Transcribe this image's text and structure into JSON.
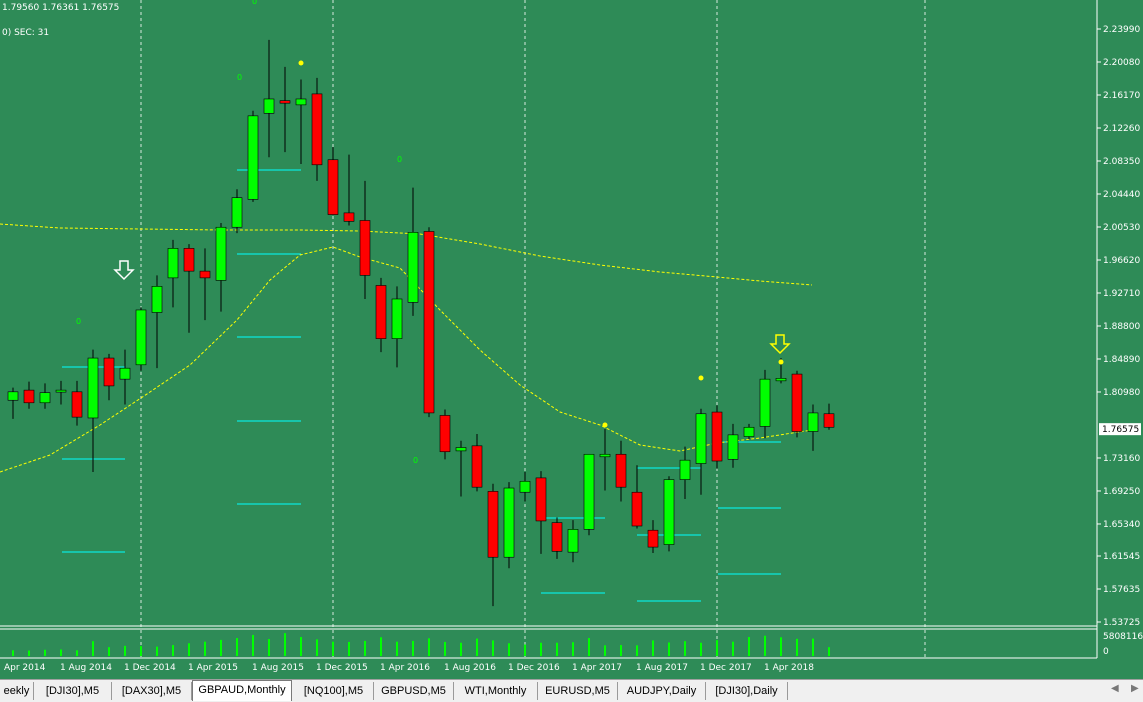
{
  "chart_data": {
    "type": "candlestick",
    "symbol": "GBPAUD",
    "timeframe": "Monthly",
    "info_line": "1.79560 1.76361 1.76575",
    "sec_line": "0)  SEC: 31",
    "current_price": "1.76575",
    "price_axis_labels": [
      "2.23990",
      "2.20080",
      "2.16170",
      "2.12260",
      "2.08350",
      "2.04440",
      "2.00530",
      "1.96620",
      "1.92710",
      "1.88800",
      "1.84890",
      "1.80980",
      "1.73160",
      "1.69250",
      "1.65340",
      "1.61545",
      "1.57635",
      "1.53725"
    ],
    "date_axis_labels": [
      "Apr 2014",
      "1 Aug 2014",
      "1 Dec 2014",
      "1 Apr 2015",
      "1 Aug 2015",
      "1 Dec 2015",
      "1 Apr 2016",
      "1 Aug 2016",
      "1 Dec 2016",
      "1 Apr 2017",
      "1 Aug 2017",
      "1 Dec 2017",
      "1 Apr 2018"
    ],
    "volume_axis_labels": [
      "5808116",
      "0"
    ],
    "zero_markers": [
      "0",
      "0",
      "0",
      "0",
      "0"
    ],
    "candles": [
      {
        "o": 1.8,
        "h": 1.815,
        "l": 1.778,
        "c": 1.81
      },
      {
        "o": 1.812,
        "h": 1.822,
        "l": 1.79,
        "c": 1.797
      },
      {
        "o": 1.797,
        "h": 1.82,
        "l": 1.79,
        "c": 1.809
      },
      {
        "o": 1.81,
        "h": 1.823,
        "l": 1.795,
        "c": 1.812
      },
      {
        "o": 1.81,
        "h": 1.823,
        "l": 1.77,
        "c": 1.78
      },
      {
        "o": 1.779,
        "h": 1.86,
        "l": 1.715,
        "c": 1.85
      },
      {
        "o": 1.85,
        "h": 1.855,
        "l": 1.8,
        "c": 1.817
      },
      {
        "o": 1.825,
        "h": 1.86,
        "l": 1.795,
        "c": 1.838
      },
      {
        "o": 1.842,
        "h": 1.91,
        "l": 1.835,
        "c": 1.907
      },
      {
        "o": 1.904,
        "h": 1.948,
        "l": 1.838,
        "c": 1.935
      },
      {
        "o": 1.945,
        "h": 1.99,
        "l": 1.91,
        "c": 1.98
      },
      {
        "o": 1.98,
        "h": 1.985,
        "l": 1.88,
        "c": 1.953
      },
      {
        "o": 1.953,
        "h": 1.98,
        "l": 1.895,
        "c": 1.945
      },
      {
        "o": 1.942,
        "h": 2.01,
        "l": 1.905,
        "c": 2.005
      },
      {
        "o": 2.005,
        "h": 2.05,
        "l": 1.998,
        "c": 2.04
      },
      {
        "o": 2.038,
        "h": 2.143,
        "l": 2.035,
        "c": 2.137
      },
      {
        "o": 2.14,
        "h": 2.227,
        "l": 2.088,
        "c": 2.157
      },
      {
        "o": 2.155,
        "h": 2.195,
        "l": 2.094,
        "c": 2.152
      },
      {
        "o": 2.15,
        "h": 2.18,
        "l": 2.08,
        "c": 2.157
      },
      {
        "o": 2.163,
        "h": 2.182,
        "l": 2.06,
        "c": 2.079
      },
      {
        "o": 2.085,
        "h": 2.1,
        "l": 2.02,
        "c": 2.02
      },
      {
        "o": 2.022,
        "h": 2.091,
        "l": 2.007,
        "c": 2.012
      },
      {
        "o": 2.013,
        "h": 2.06,
        "l": 1.92,
        "c": 1.948
      },
      {
        "o": 1.936,
        "h": 1.945,
        "l": 1.857,
        "c": 1.873
      },
      {
        "o": 1.873,
        "h": 1.935,
        "l": 1.839,
        "c": 1.92
      },
      {
        "o": 1.916,
        "h": 2.052,
        "l": 1.9,
        "c": 1.999
      },
      {
        "o": 2.0,
        "h": 2.005,
        "l": 1.78,
        "c": 1.785
      },
      {
        "o": 1.782,
        "h": 1.789,
        "l": 1.73,
        "c": 1.739
      },
      {
        "o": 1.74,
        "h": 1.752,
        "l": 1.686,
        "c": 1.744
      },
      {
        "o": 1.746,
        "h": 1.76,
        "l": 1.692,
        "c": 1.697
      },
      {
        "o": 1.692,
        "h": 1.701,
        "l": 1.556,
        "c": 1.614
      },
      {
        "o": 1.614,
        "h": 1.703,
        "l": 1.601,
        "c": 1.696
      },
      {
        "o": 1.691,
        "h": 1.715,
        "l": 1.68,
        "c": 1.704
      },
      {
        "o": 1.708,
        "h": 1.716,
        "l": 1.618,
        "c": 1.657
      },
      {
        "o": 1.655,
        "h": 1.661,
        "l": 1.612,
        "c": 1.621
      },
      {
        "o": 1.62,
        "h": 1.658,
        "l": 1.608,
        "c": 1.647
      },
      {
        "o": 1.647,
        "h": 1.735,
        "l": 1.64,
        "c": 1.736
      },
      {
        "o": 1.733,
        "h": 1.766,
        "l": 1.693,
        "c": 1.736
      },
      {
        "o": 1.736,
        "h": 1.752,
        "l": 1.68,
        "c": 1.697
      },
      {
        "o": 1.691,
        "h": 1.723,
        "l": 1.648,
        "c": 1.651
      },
      {
        "o": 1.646,
        "h": 1.658,
        "l": 1.619,
        "c": 1.626
      },
      {
        "o": 1.629,
        "h": 1.71,
        "l": 1.621,
        "c": 1.706
      },
      {
        "o": 1.706,
        "h": 1.745,
        "l": 1.683,
        "c": 1.729
      },
      {
        "o": 1.725,
        "h": 1.79,
        "l": 1.688,
        "c": 1.784
      },
      {
        "o": 1.786,
        "h": 1.794,
        "l": 1.719,
        "c": 1.728
      },
      {
        "o": 1.73,
        "h": 1.772,
        "l": 1.72,
        "c": 1.759
      },
      {
        "o": 1.757,
        "h": 1.772,
        "l": 1.754,
        "c": 1.768
      },
      {
        "o": 1.769,
        "h": 1.836,
        "l": 1.755,
        "c": 1.825
      },
      {
        "o": 1.823,
        "h": 1.85,
        "l": 1.82,
        "c": 1.826
      },
      {
        "o": 1.831,
        "h": 1.835,
        "l": 1.756,
        "c": 1.763
      },
      {
        "o": 1.763,
        "h": 1.795,
        "l": 1.74,
        "c": 1.785
      },
      {
        "o": 1.784,
        "h": 1.796,
        "l": 1.765,
        "c": 1.768
      }
    ],
    "volumes": [
      0.22,
      0.21,
      0.24,
      0.25,
      0.22,
      0.57,
      0.34,
      0.39,
      0.38,
      0.36,
      0.42,
      0.49,
      0.55,
      0.62,
      0.69,
      0.81,
      0.65,
      0.88,
      0.73,
      0.64,
      0.55,
      0.54,
      0.58,
      0.72,
      0.55,
      0.58,
      0.68,
      0.54,
      0.51,
      0.67,
      0.6,
      0.49,
      0.44,
      0.51,
      0.51,
      0.53,
      0.69,
      0.41,
      0.42,
      0.41,
      0.6,
      0.52,
      0.57,
      0.51,
      0.61,
      0.55,
      0.73,
      0.78,
      0.72,
      0.66,
      0.67,
      0.34
    ]
  },
  "tabs": [
    {
      "label": "eekly",
      "active": false
    },
    {
      "label": "[DJI30],M5",
      "active": false
    },
    {
      "label": "[DAX30],M5",
      "active": false
    },
    {
      "label": "GBPAUD,Monthly",
      "active": true
    },
    {
      "label": "[NQ100],M5",
      "active": false
    },
    {
      "label": "GBPUSD,M5",
      "active": false
    },
    {
      "label": "WTI,Monthly",
      "active": false
    },
    {
      "label": "EURUSD,M5",
      "active": false
    },
    {
      "label": "AUDJPY,Daily",
      "active": false
    },
    {
      "label": "[DJI30],Daily",
      "active": false
    }
  ],
  "nav": {
    "left": "◀",
    "right": "▶"
  },
  "colors": {
    "background": "#2e8b57",
    "bull": "#00ff00",
    "bear": "#ff0000",
    "ma": "#ffff00",
    "level": "#00ffff",
    "grid": "#ffffff",
    "text": "#ffffff"
  }
}
